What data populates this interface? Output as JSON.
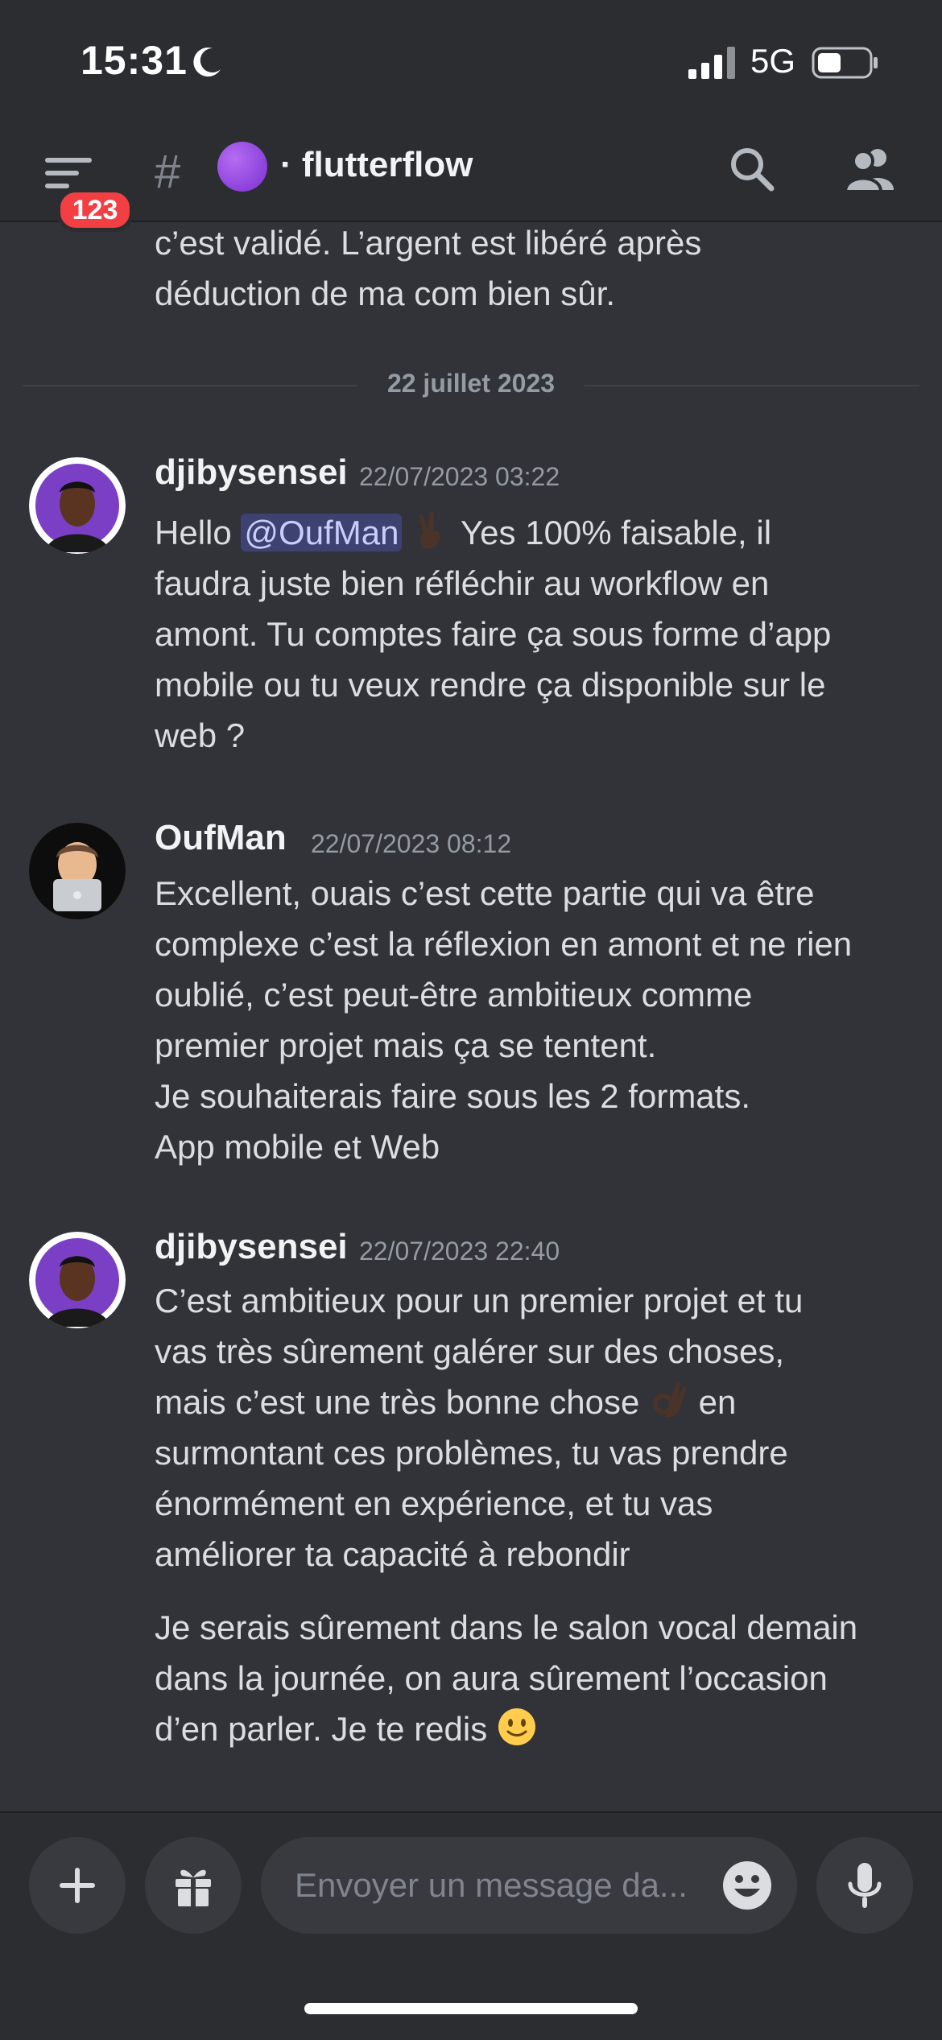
{
  "status_bar": {
    "time": "15:31",
    "network": "5G",
    "signal": "signal-icon",
    "battery": "battery-icon"
  },
  "header": {
    "badge": "123",
    "channel_hash": "#",
    "channel_name": "· flutterflow",
    "icons": [
      "menu-icon",
      "search-icon",
      "members-icon"
    ]
  },
  "prev_message": "c’est validé. L’argent est libéré après\ndéduction de ma com bien sûr.",
  "date_divider": "22 juillet 2023",
  "messages": [
    {
      "username": "djibysensei",
      "timestamp": "22/07/2023 03:22",
      "mention": "@OufMan",
      "before": "Hello ",
      "after": " Yes 100% faisable, il\nfaudra juste bien réfléchir au workflow en\namont. Tu comptes faire ça sous forme d’app\nmobile ou tu veux rendre ça disponible sur le\nweb ?"
    },
    {
      "username": "OufMan",
      "timestamp": "22/07/2023 08:12",
      "text": "Excellent, ouais c’est cette partie qui va être\ncomplexe c’est la réflexion en amont et ne rien\noublié, c’est peut-être ambitieux comme\npremier projet mais ça se tentent.\nJe souhaiterais faire sous les 2 formats.\nApp mobile et Web"
    },
    {
      "username": "djibysensei",
      "timestamp": "22/07/2023 22:40",
      "line1": "C’est ambitieux pour un premier projet et tu\nvas très sûrement galérer sur des choses,",
      "line2_before": "mais c’est une très bonne chose ",
      "line2_after": " en",
      "line3": "surmontant ces problèmes, tu vas prendre\nénormément en expérience, et tu vas\naméliorer ta capacité à rebondir",
      "text2_part1": "Je serais sûrement dans le salon vocal demain\ndans la journée, on aura sûrement l’occasion",
      "text2_part2": "d’en parler. Je te redis "
    }
  ],
  "input": {
    "placeholder": "Envoyer un message da..."
  },
  "colors": {
    "background": "#313338",
    "chrome": "#2b2d31",
    "badge": "#f23f43",
    "mention_bg": "#3e4270"
  }
}
